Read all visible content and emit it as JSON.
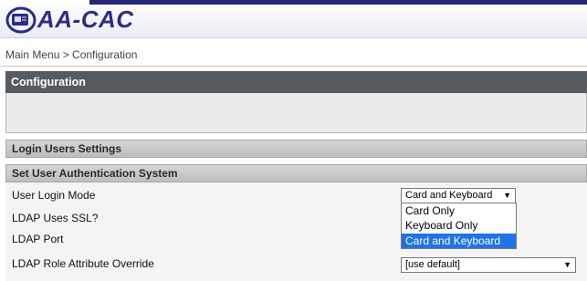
{
  "app": {
    "title": "AA-CAC"
  },
  "breadcrumb": {
    "text": "Main Menu > Configuration"
  },
  "panel": {
    "title": "Configuration"
  },
  "sections": {
    "login_users": "Login Users Settings",
    "auth_system": "Set User Authentication System"
  },
  "form": {
    "user_login_mode": {
      "label": "User Login Mode",
      "value": "Card and Keyboard",
      "options": [
        "Card Only",
        "Keyboard Only",
        "Card and Keyboard"
      ]
    },
    "ldap_ssl": {
      "label": "LDAP Uses SSL?"
    },
    "ldap_port": {
      "label": "LDAP Port"
    },
    "ldap_role": {
      "label": "LDAP Role Attribute Override",
      "value": "[use default]"
    }
  },
  "icons": {
    "logo": "smart-card-logo-icon",
    "caret": "caret-down-icon"
  },
  "colors": {
    "brand": "#2b2e86",
    "header_stripe": "#25257a",
    "panel_header": "#555b60",
    "selected_option": "#1e73e8"
  }
}
